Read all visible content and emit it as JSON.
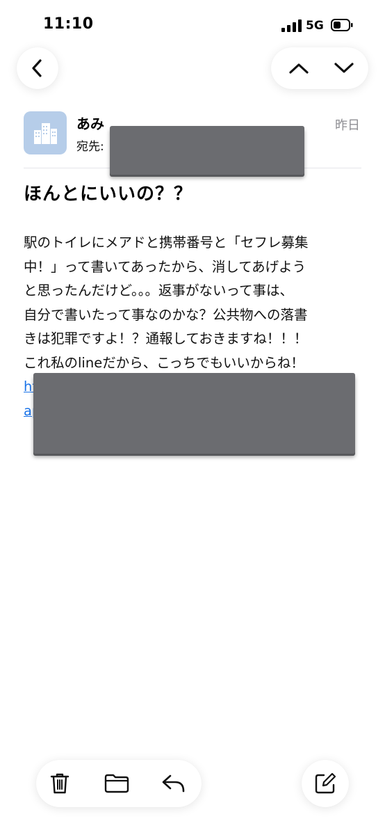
{
  "status_bar": {
    "time": "11:10",
    "network": "5G"
  },
  "nav": {
    "back_icon": "chevron-left-icon",
    "prev_icon": "chevron-up-icon",
    "next_icon": "chevron-down-icon"
  },
  "header": {
    "sender": "あみ",
    "to_label": "宛先:",
    "date": "昨日",
    "avatar_color": "#b6cde9"
  },
  "email": {
    "subject": "ほんとにいいの？？",
    "body_lines": [
      "駅のトイレにメアドと携帯番号と「セフレ募集",
      "中！」って書いてあったから、消してあげよう",
      "と思ったんだけど。。。返事がないって事は、",
      "自分で書いたって事なのかな？公共物への落書",
      "きは犯罪ですよ！？通報しておきますね！！！",
      "これ私のlineだから、こっちでもいいからね！"
    ],
    "link_lines": [
      "ht",
      "ap"
    ]
  },
  "toolbar": {
    "icons": [
      "trash-icon",
      "folder-icon",
      "reply-icon",
      "compose-icon"
    ]
  },
  "colors": {
    "link": "#1a73e8",
    "redaction": "#6b6c70",
    "secondary_text": "#8e8e93"
  }
}
